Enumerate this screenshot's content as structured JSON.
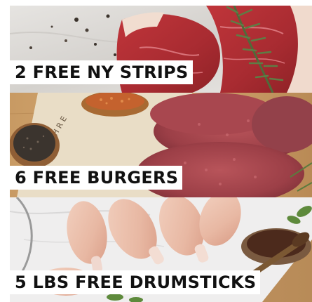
{
  "offers": [
    {
      "label": "2 FREE NY STRIPS",
      "image": "ny-strip-steaks-with-rosemary"
    },
    {
      "label": "6 FREE BURGERS",
      "image": "raw-burger-patties-with-spices"
    },
    {
      "label": "5 LBS FREE DRUMSTICKS",
      "image": "raw-chicken-drumsticks-with-sauce"
    }
  ]
}
